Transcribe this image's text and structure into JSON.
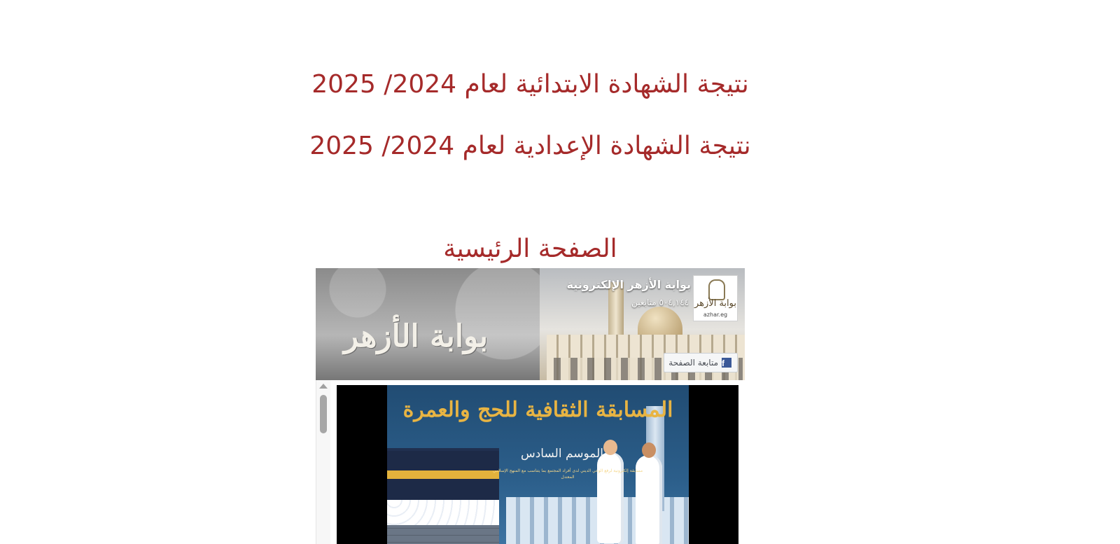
{
  "links": {
    "primary_result": "نتيجة الشهادة الابتدائية لعام 2024/ 2025",
    "prep_result": "نتيجة الشهادة الإعدادية لعام 2024/ 2025"
  },
  "home_title": "الصفحة الرئيسية",
  "facebook_plugin": {
    "page_name": "بوابة الأزهر الإلكترونية",
    "followers": "٥٠٤,١٤٤ متابعين",
    "follow_button_label": "متابعة الصفحة",
    "avatar_text": "بوابة الأزهر",
    "avatar_domain": "azhar.eg",
    "cover_text": "بوابة الأزهر",
    "post_image": {
      "title": "المسابقة الثقافية للحج والعمرة",
      "subtitle": "الموسم السادس",
      "description": "مسابقة إلكترونية لرفع الوعي الديني لدى أفراد المجتمع بما يتناسب مع المنهج الإسلامي المعتدل"
    }
  },
  "colors": {
    "link": "#a52a2a",
    "facebook_blue": "#3b5998"
  },
  "icons": {
    "facebook": "facebook-f-icon",
    "scroll_up": "triangle-up-icon"
  }
}
